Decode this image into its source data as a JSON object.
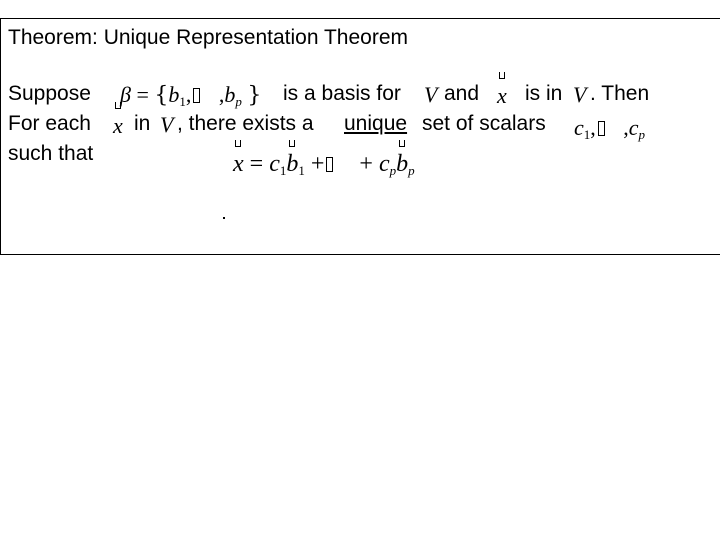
{
  "slide": {
    "title": "Theorem:  Unique Representation Theorem",
    "line1": {
      "lead": "Suppose",
      "beta": "β",
      "equals": "=",
      "open_brace": "{",
      "b1": "b",
      "b1_sub": "1",
      "comma1": ",",
      "comma2": ",",
      "bp": "b",
      "bp_sub": "p",
      "close_brace": "}",
      "mid": "is a basis for",
      "V": "V",
      "and": "and",
      "x": "x",
      "tail": "is in",
      "V2": "V",
      "end": ".  Then"
    },
    "line2": {
      "lead": "For each",
      "x": "x",
      "in": "in",
      "V": "V",
      "mid": ", there exists a",
      "unique": "unique",
      "tail": "set of scalars",
      "c1": "c",
      "c1_sub": "1",
      "comma1": ",",
      "comma2": ",",
      "cp": "c",
      "cp_sub": "p"
    },
    "line3": {
      "lead": "such that"
    },
    "equation": {
      "x": "x",
      "equals": "=",
      "c1": "c",
      "c1_sub": "1",
      "b1": "b",
      "b1_sub": "1",
      "plus1": "+",
      "plus2": "+",
      "cp": "c",
      "cp_sub": "p",
      "bp": "b",
      "bp_sub": "p"
    }
  }
}
